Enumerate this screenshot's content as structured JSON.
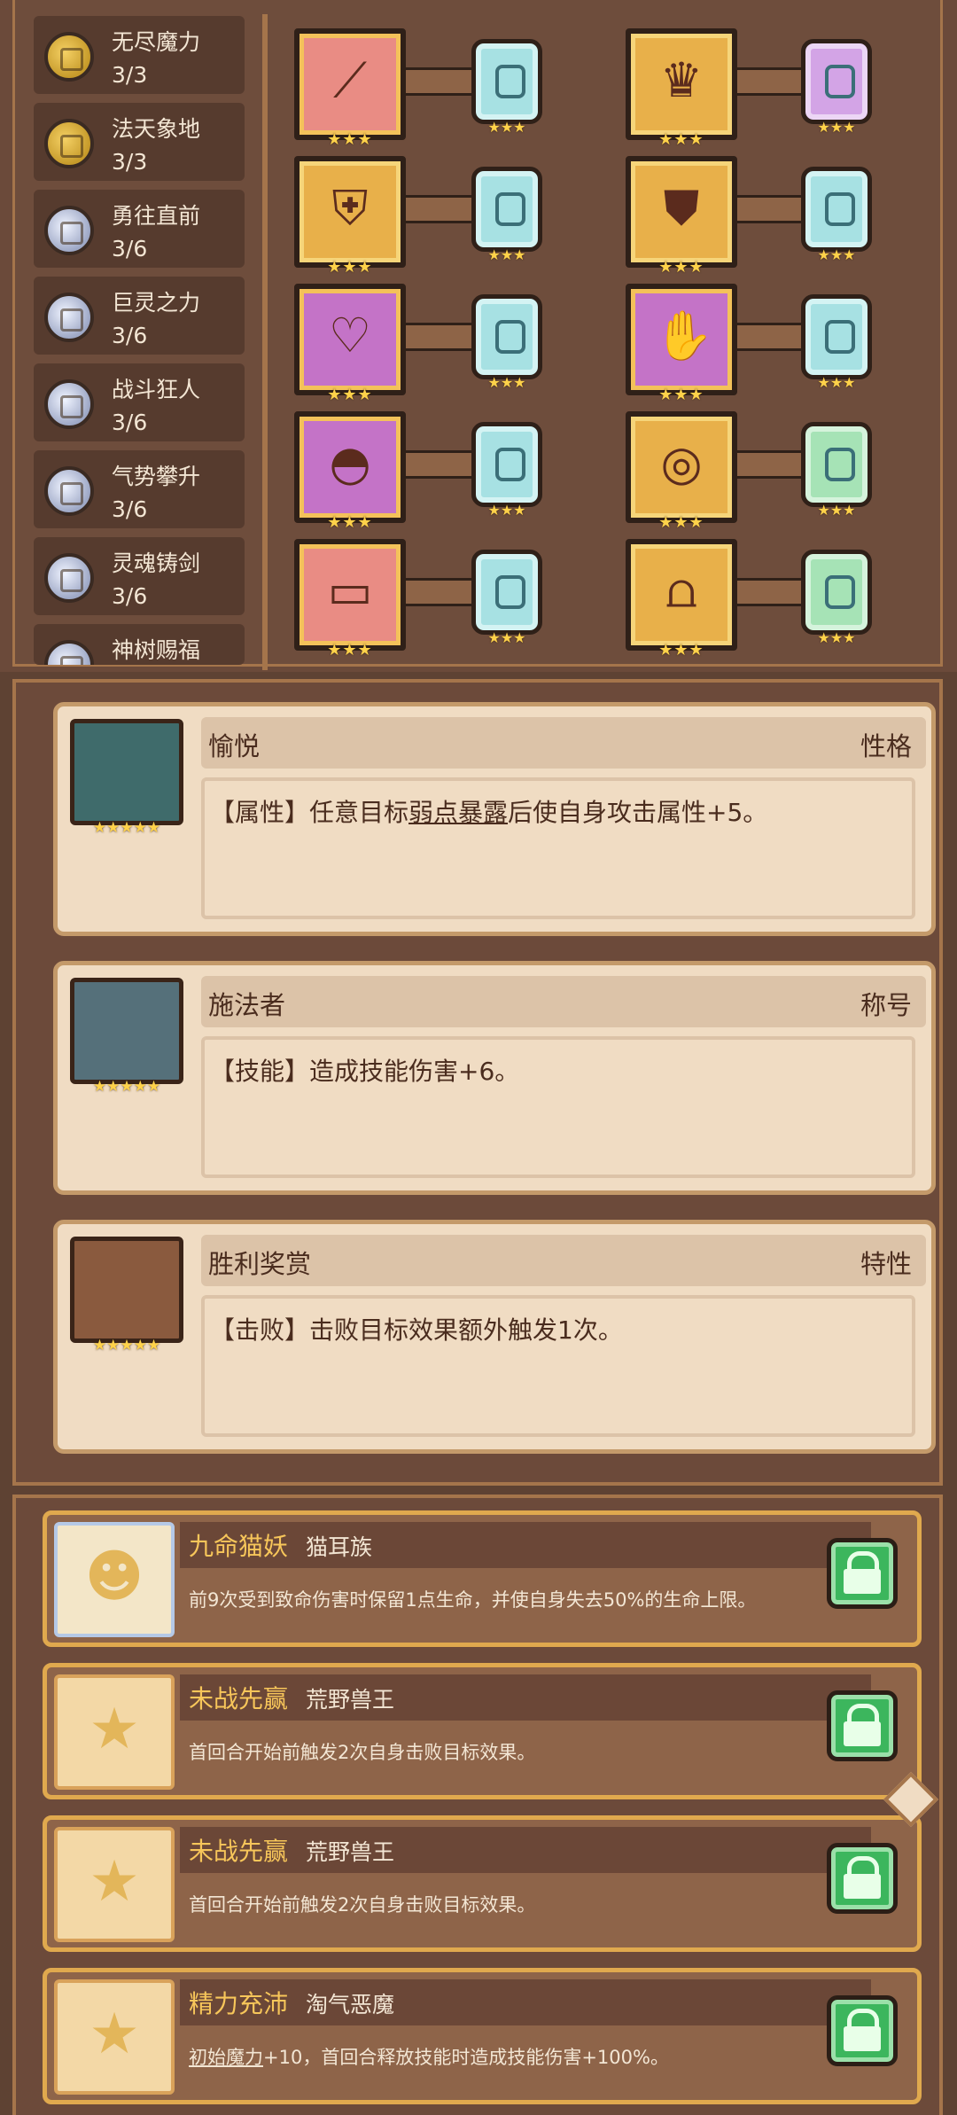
{
  "sets": [
    {
      "name": "无尽魔力",
      "count": "3/3",
      "color": "gold"
    },
    {
      "name": "法天象地",
      "count": "3/3",
      "color": "gold"
    },
    {
      "name": "勇往直前",
      "count": "3/6",
      "color": "silver"
    },
    {
      "name": "巨灵之力",
      "count": "3/6",
      "color": "silver"
    },
    {
      "name": "战斗狂人",
      "count": "3/6",
      "color": "silver"
    },
    {
      "name": "气势攀升",
      "count": "3/6",
      "color": "silver"
    },
    {
      "name": "灵魂铸剑",
      "count": "3/6",
      "color": "silver"
    },
    {
      "name": "神树赐福",
      "count": "",
      "color": "silver"
    }
  ],
  "equipment_stars": "★★★",
  "traits": [
    {
      "name": "愉悦",
      "type": "性格",
      "desc_pre": "【属性】任意目标",
      "desc_link": "弱点暴露",
      "desc_post": "后使自身攻击属性+5。",
      "stars": "★★★★★"
    },
    {
      "name": "施法者",
      "type": "称号",
      "desc_pre": "【技能】造成技能伤害+6。",
      "desc_link": "",
      "desc_post": "",
      "stars": "★★★★★"
    },
    {
      "name": "胜利奖赏",
      "type": "特性",
      "desc_pre": "【击败】击败目标效果额外触发1次。",
      "desc_link": "",
      "desc_post": "",
      "stars": "★★★★★"
    }
  ],
  "races": [
    {
      "name": "九命猫妖",
      "type": "猫耳族",
      "desc_pre": "前9次受到致命伤害时保留1点生命，并使自身失去50%的生命上限。",
      "desc_link": "",
      "desc_post": ""
    },
    {
      "name": "未战先赢",
      "type": "荒野兽王",
      "desc_pre": "首回合开始前触发2次自身击败目标效果。",
      "desc_link": "",
      "desc_post": ""
    },
    {
      "name": "未战先赢",
      "type": "荒野兽王",
      "desc_pre": "首回合开始前触发2次自身击败目标效果。",
      "desc_link": "",
      "desc_post": ""
    },
    {
      "name": "精力充沛",
      "type": "淘气恶魔",
      "desc_pre": "",
      "desc_link": "初始魔力",
      "desc_post": "+10，首回合释放技能时造成技能伤害+100%。"
    }
  ],
  "icons": {
    "lock": "lock-icon",
    "cat": "cat-face-icon",
    "star": "star-icon"
  }
}
